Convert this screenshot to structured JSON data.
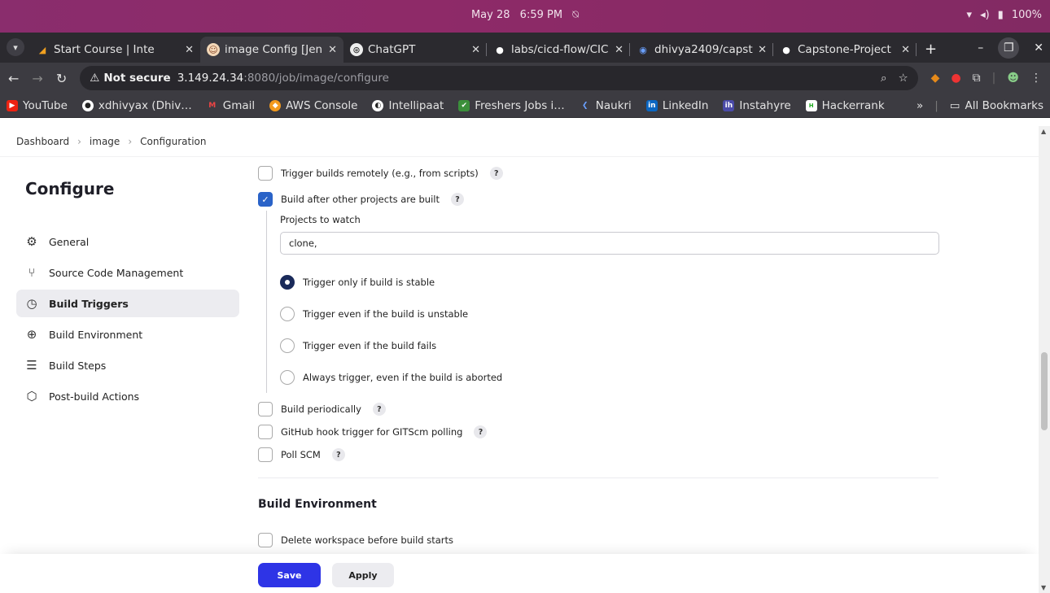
{
  "os": {
    "date": "May 28",
    "time": "6:59 PM",
    "battery": "100%"
  },
  "tabs": [
    {
      "label": "Start Course | Inte",
      "active": false
    },
    {
      "label": "image Config [Jen",
      "active": true
    },
    {
      "label": "ChatGPT",
      "active": false
    },
    {
      "label": "labs/cicd-flow/CIC",
      "active": false
    },
    {
      "label": "dhivya2409/capst",
      "active": false
    },
    {
      "label": "Capstone-Project",
      "active": false
    }
  ],
  "toolbar": {
    "security": "Not secure",
    "url_host": "3.149.24.34",
    "url_path": ":8080/job/image/configure"
  },
  "bookmarks": [
    "YouTube",
    "xdhivyax (Dhiv…",
    "Gmail",
    "AWS Console",
    "Intellipaat",
    "Freshers Jobs i…",
    "Naukri",
    "LinkedIn",
    "Instahyre",
    "Hackerrank"
  ],
  "bookmarks_more": "All Bookmarks",
  "breadcrumbs": [
    "Dashboard",
    "image",
    "Configuration"
  ],
  "sidebar": {
    "title": "Configure",
    "items": [
      {
        "label": "General",
        "icon": "gear-icon"
      },
      {
        "label": "Source Code Management",
        "icon": "branch-icon"
      },
      {
        "label": "Build Triggers",
        "icon": "clock-icon",
        "active": true
      },
      {
        "label": "Build Environment",
        "icon": "globe-icon"
      },
      {
        "label": "Build Steps",
        "icon": "list-icon"
      },
      {
        "label": "Post-build Actions",
        "icon": "package-icon"
      }
    ]
  },
  "triggers": {
    "remote": "Trigger builds remotely (e.g., from scripts)",
    "after_other": "Build after other projects are built",
    "projects_label": "Projects to watch",
    "projects_value": "clone,",
    "radio_options": [
      "Trigger only if build is stable",
      "Trigger even if the build is unstable",
      "Trigger even if the build fails",
      "Always trigger, even if the build is aborted"
    ],
    "periodically": "Build periodically",
    "github_hook": "GitHub hook trigger for GITScm polling",
    "poll_scm": "Poll SCM"
  },
  "build_env": {
    "heading": "Build Environment",
    "delete_ws": "Delete workspace before build starts"
  },
  "buttons": {
    "save": "Save",
    "apply": "Apply"
  },
  "help_mark": "?"
}
